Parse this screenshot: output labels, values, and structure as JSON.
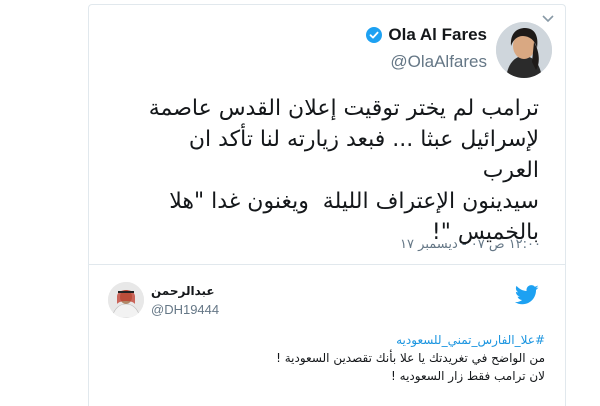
{
  "main_tweet": {
    "author_name": "Ola Al Fares",
    "author_handle": "@OlaAlfares",
    "text": "ترامب لم يختر توقيت إعلان القدس عاصمة\nلإسرائيل عبثا ... فبعد زيارته لنا تأكد ان العرب\nسيدينون الإعتراف الليلة  ويغنون غدا \"هلا\nبالخميس \"!",
    "timestamp": "١٢:٠٠ ص ٠٧ - ديسمبر ١٧"
  },
  "reply_tweet": {
    "author_name": "عبدالرحمن",
    "author_handle": "@DH19444",
    "hashtag": "#علا_الفارس_تمني_للسعوديه",
    "line1": "من الواضح في تغريدتك يا علا بأنك تقصدين السعودية !",
    "line2": "لان ترامب فقط زار السعوديه !"
  },
  "colors": {
    "link": "#1b95e0",
    "verified": "#1da1f2",
    "secondary_text": "#657786",
    "border": "#e1e8ed"
  },
  "icons": [
    "chevron-down-icon",
    "verified-badge-icon",
    "twitter-bird-icon"
  ]
}
